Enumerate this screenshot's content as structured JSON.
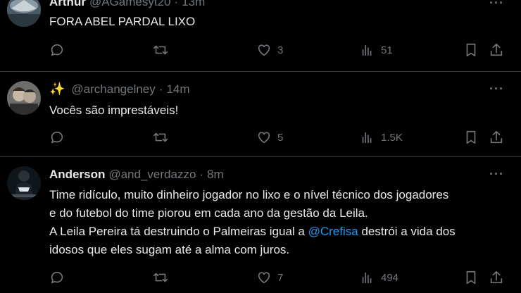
{
  "tweets": [
    {
      "name": "Arthur",
      "handle": "@AGamesyt20",
      "time": "13m",
      "text": "FORA ABEL PARDAL LIXO",
      "replies": "",
      "retweets": "",
      "likes": "3",
      "views": "51"
    },
    {
      "name": "✨",
      "handle": "@archangelney",
      "time": "14m",
      "text": "Vocês são imprestáveis!",
      "replies": "",
      "retweets": "",
      "likes": "5",
      "views": "1.5K"
    },
    {
      "name": "Anderson",
      "handle": "@and_verdazzo",
      "time": "8m",
      "text_lines": [
        "Time ridículo, muito dinheiro jogador no lixo e o nível técnico dos jogadores",
        "e do futebol do time piorou em cada ano da gestão da Leila."
      ],
      "text_line3_before": "A Leila Pereira tá destruindo o Palmeiras igual a ",
      "mention": "@Crefisa",
      "text_line3_after": " destrói a vida dos",
      "text_line4": "idosos que eles sugam até a alma com juros.",
      "replies": "",
      "retweets": "",
      "likes": "7",
      "views": "494"
    }
  ],
  "dot": "·",
  "more": "···",
  "icons": [
    "reply-icon",
    "retweet-icon",
    "like-icon",
    "views-icon",
    "bookmark-icon",
    "share-icon"
  ],
  "colors": {
    "background": "#000000",
    "text": "#e7e9ea",
    "muted": "#71767b",
    "link": "#1d9bf0",
    "separator": "#2f3336"
  }
}
